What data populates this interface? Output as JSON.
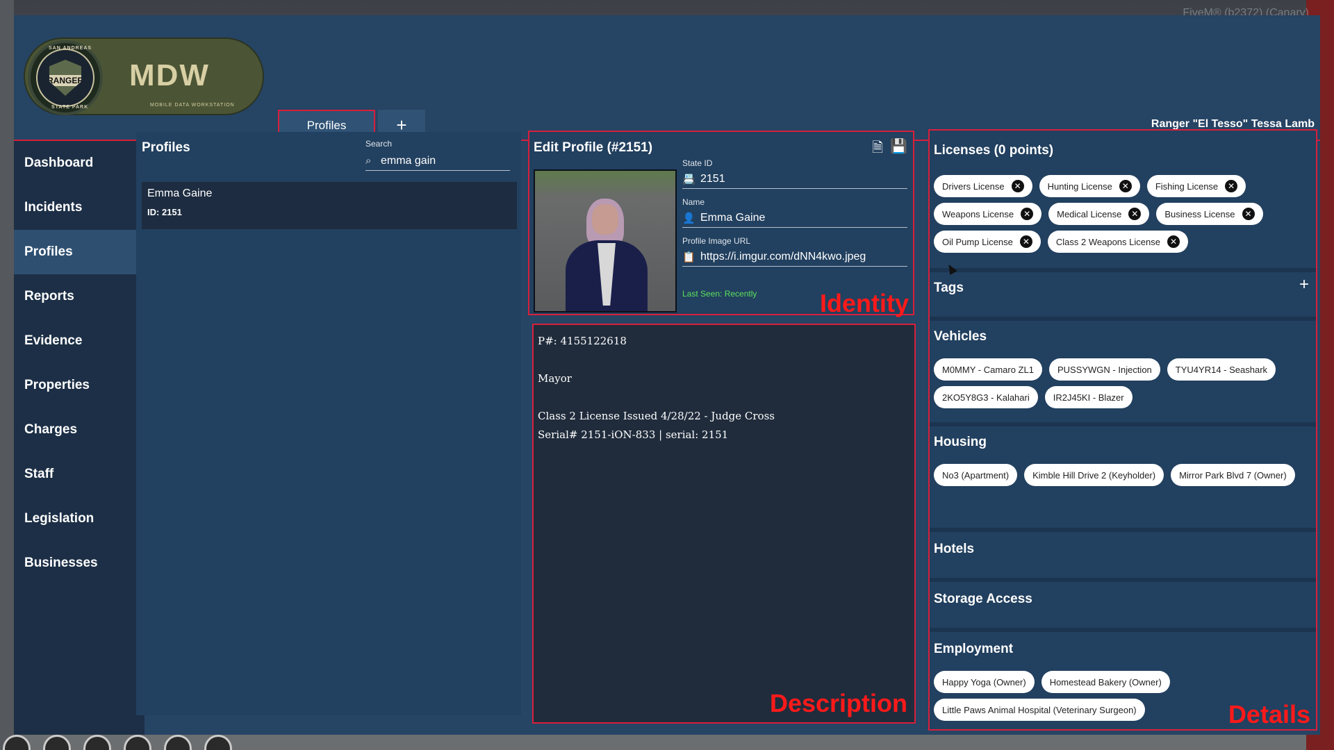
{
  "overlay": {
    "fivem_label": "FiveM® (b2372) (Canary)"
  },
  "logo": {
    "badge_text": "RANGER",
    "arc_top": "SAN ANDREAS",
    "arc_bottom": "STATE PARK",
    "title": "MDW",
    "subtitle": "MOBILE DATA WORKSTATION"
  },
  "tabs": [
    {
      "label": "Profiles"
    },
    {
      "label": "+"
    }
  ],
  "user": {
    "name": "Ranger \"El Tesso\" Tessa Lamb"
  },
  "sidebar": {
    "items": [
      {
        "label": "Dashboard"
      },
      {
        "label": "Incidents"
      },
      {
        "label": "Profiles"
      },
      {
        "label": "Reports"
      },
      {
        "label": "Evidence"
      },
      {
        "label": "Properties"
      },
      {
        "label": "Charges"
      },
      {
        "label": "Staff"
      },
      {
        "label": "Legislation"
      },
      {
        "label": "Businesses"
      }
    ],
    "active": "Profiles"
  },
  "list": {
    "title": "Profiles",
    "search_label": "Search",
    "search_value": "emma gain",
    "results": [
      {
        "name": "Emma Gaine",
        "id": "ID: 2151"
      }
    ]
  },
  "identity": {
    "title": "Edit Profile (#2151)",
    "state_id_label": "State ID",
    "state_id": "2151",
    "name_label": "Name",
    "name": "Emma Gaine",
    "image_label": "Profile Image URL",
    "image_url": "https://i.imgur.com/dNN4kwo.jpeg",
    "last_seen": "Last Seen: Recently",
    "annotation": "Identity"
  },
  "description": {
    "lines": [
      "P#: 4155122618",
      "",
      "Mayor",
      "",
      "Class 2 License Issued 4/28/22 - Judge Cross",
      "Serial# 2151-iON-833 | serial: 2151"
    ],
    "annotation": "Description"
  },
  "details": {
    "annotation": "Details",
    "licenses": {
      "title": "Licenses (0 points)",
      "items": [
        "Drivers License",
        "Hunting License",
        "Fishing License",
        "Weapons License",
        "Medical License",
        "Business License",
        "Oil Pump License",
        "Class 2 Weapons License"
      ]
    },
    "tags": {
      "title": "Tags",
      "add": "+"
    },
    "vehicles": {
      "title": "Vehicles",
      "items": [
        "M0MMY - Camaro ZL1",
        "PUSSYWGN - Injection",
        "TYU4YR14 - Seashark",
        "2KO5Y8G3 - Kalahari",
        "IR2J45KI - Blazer"
      ]
    },
    "housing": {
      "title": "Housing",
      "items": [
        "No3 (Apartment)",
        "Kimble Hill Drive 2 (Keyholder)",
        "Mirror Park Blvd 7 (Owner)"
      ]
    },
    "hotels": {
      "title": "Hotels"
    },
    "storage": {
      "title": "Storage Access"
    },
    "employment": {
      "title": "Employment",
      "items": [
        "Happy Yoga (Owner)",
        "Homestead Bakery (Owner)",
        "Little Paws Animal Hospital (Veterinary Surgeon)"
      ]
    }
  },
  "colors": {
    "panel": "#22405f",
    "accent": "#d81f3c",
    "annotation": "#ff1a1a",
    "last_seen": "#5de05d"
  }
}
